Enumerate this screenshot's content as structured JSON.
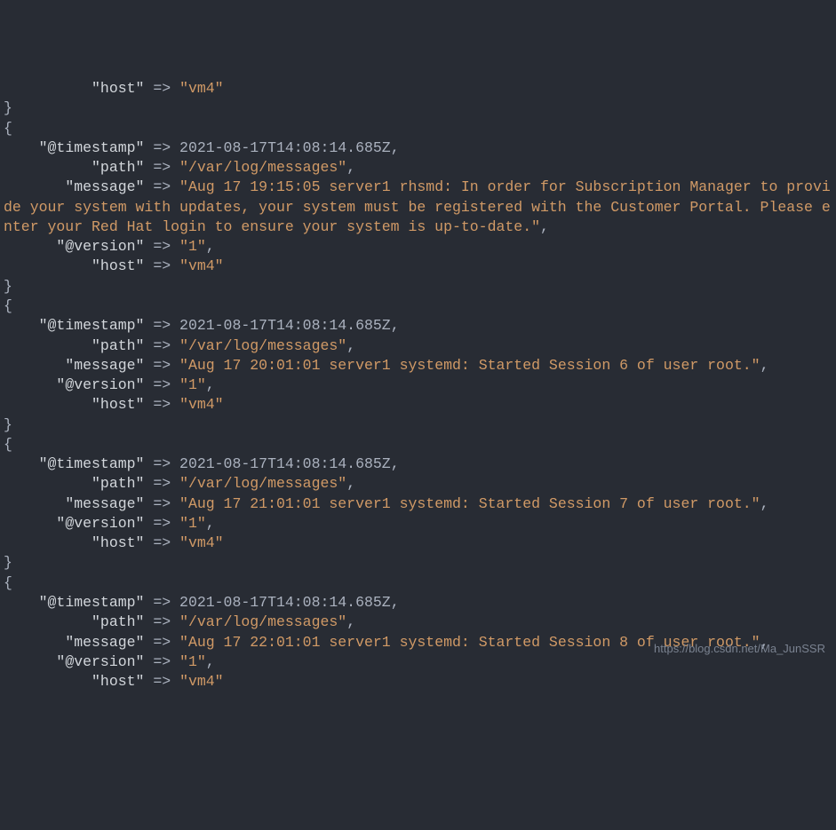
{
  "records": [
    {
      "partial_start": true,
      "fields": [
        {
          "key": "\"host\"",
          "pad": 10,
          "val": "\"vm4\"",
          "type": "string",
          "trailing": ""
        }
      ],
      "close_brace": true,
      "open_brace_next": true
    },
    {
      "fields": [
        {
          "key": "\"@timestamp\"",
          "pad": 4,
          "val": "2021-08-17T14:08:14.685Z",
          "type": "timestamp",
          "trailing": ","
        },
        {
          "key": "\"path\"",
          "pad": 10,
          "val": "\"/var/log/messages\"",
          "type": "string",
          "trailing": ","
        },
        {
          "key": "\"message\"",
          "pad": 7,
          "val": "\"Aug 17 19:15:05 server1 rhsmd: In order for Subscription Manager to provide your system with updates, your system must be registered with the Customer Portal. Please enter your Red Hat login to ensure your system is up-to-date.\"",
          "type": "string",
          "trailing": ","
        },
        {
          "key": "\"@version\"",
          "pad": 6,
          "val": "\"1\"",
          "type": "string",
          "trailing": ","
        },
        {
          "key": "\"host\"",
          "pad": 10,
          "val": "\"vm4\"",
          "type": "string",
          "trailing": ""
        }
      ],
      "close_brace": true,
      "open_brace_next": true
    },
    {
      "fields": [
        {
          "key": "\"@timestamp\"",
          "pad": 4,
          "val": "2021-08-17T14:08:14.685Z",
          "type": "timestamp",
          "trailing": ","
        },
        {
          "key": "\"path\"",
          "pad": 10,
          "val": "\"/var/log/messages\"",
          "type": "string",
          "trailing": ","
        },
        {
          "key": "\"message\"",
          "pad": 7,
          "val": "\"Aug 17 20:01:01 server1 systemd: Started Session 6 of user root.\"",
          "type": "string",
          "trailing": ","
        },
        {
          "key": "\"@version\"",
          "pad": 6,
          "val": "\"1\"",
          "type": "string",
          "trailing": ","
        },
        {
          "key": "\"host\"",
          "pad": 10,
          "val": "\"vm4\"",
          "type": "string",
          "trailing": ""
        }
      ],
      "close_brace": true,
      "open_brace_next": true
    },
    {
      "fields": [
        {
          "key": "\"@timestamp\"",
          "pad": 4,
          "val": "2021-08-17T14:08:14.685Z",
          "type": "timestamp",
          "trailing": ","
        },
        {
          "key": "\"path\"",
          "pad": 10,
          "val": "\"/var/log/messages\"",
          "type": "string",
          "trailing": ","
        },
        {
          "key": "\"message\"",
          "pad": 7,
          "val": "\"Aug 17 21:01:01 server1 systemd: Started Session 7 of user root.\"",
          "type": "string",
          "trailing": ","
        },
        {
          "key": "\"@version\"",
          "pad": 6,
          "val": "\"1\"",
          "type": "string",
          "trailing": ","
        },
        {
          "key": "\"host\"",
          "pad": 10,
          "val": "\"vm4\"",
          "type": "string",
          "trailing": ""
        }
      ],
      "close_brace": true,
      "open_brace_next": true
    },
    {
      "fields": [
        {
          "key": "\"@timestamp\"",
          "pad": 4,
          "val": "2021-08-17T14:08:14.685Z",
          "type": "timestamp",
          "trailing": ","
        },
        {
          "key": "\"path\"",
          "pad": 10,
          "val": "\"/var/log/messages\"",
          "type": "string",
          "trailing": ","
        },
        {
          "key": "\"message\"",
          "pad": 7,
          "val": "\"Aug 17 22:01:01 server1 systemd: Started Session 8 of user root.\"",
          "type": "string",
          "trailing": ","
        },
        {
          "key": "\"@version\"",
          "pad": 6,
          "val": "\"1\"",
          "type": "string",
          "trailing": ","
        },
        {
          "key": "\"host\"",
          "pad": 10,
          "val": "\"vm4\"",
          "type": "string",
          "trailing": ""
        }
      ],
      "close_brace": false,
      "open_brace_next": false
    }
  ],
  "watermark": "https://blog.csdn.net/Ma_JunSSR"
}
